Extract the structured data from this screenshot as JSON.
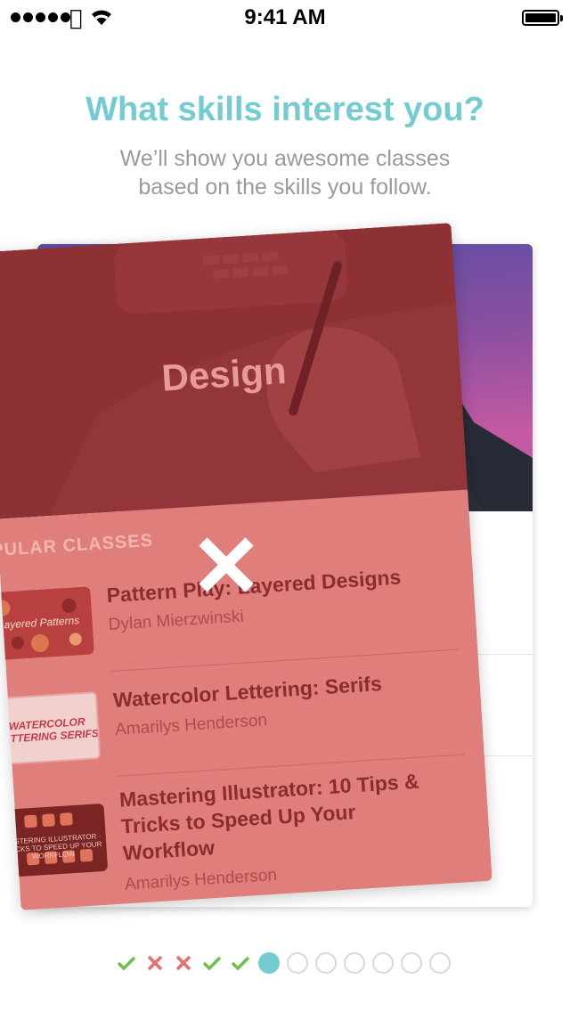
{
  "status": {
    "time": "9:41 AM"
  },
  "header": {
    "title": "What skills interest you?",
    "subtitle_line1": "We’ll show you awesome classes",
    "subtitle_line2": "based on the skills you follow."
  },
  "card": {
    "category": "Design",
    "section_label": "PULAR CLASSES",
    "classes": [
      {
        "title": "Pattern Play: Layered Designs",
        "author": "Dylan Mierzwinski",
        "thumb_text": "Layered Patterns"
      },
      {
        "title": "Watercolor Lettering: Serifs",
        "author": "Amarilys Henderson",
        "thumb_text": "WATERCOLOR LETTERING SERIFS"
      },
      {
        "title_line1": "Mastering Illustrator: 10 Tips &",
        "title_line2": "Tricks to Speed Up Your",
        "title_line3": "Workflow",
        "author": "Amarilys Henderson",
        "thumb_text": "MASTERING ILLUSTRATOR · TRICKS TO SPEED UP YOUR WORKFLOW"
      }
    ]
  },
  "pager": {
    "results": [
      "check",
      "cross",
      "cross",
      "check",
      "check"
    ],
    "current_index": 5,
    "remaining": 6
  },
  "colors": {
    "accent": "#74ccd0",
    "check": "#6cc04a",
    "cross": "#e2706e",
    "front_body": "#e07e7c",
    "front_hero": "#8d3135"
  }
}
